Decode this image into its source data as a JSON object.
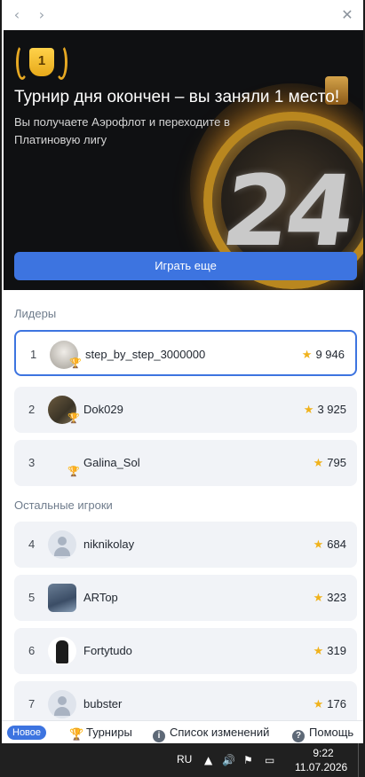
{
  "nav": {
    "back": "‹",
    "forward": "›",
    "close": "✕"
  },
  "hero": {
    "badge_number": "1",
    "title": "Турнир дня окончен – вы заняли 1 место!",
    "subtitle": "Вы получаете Аэрофлот и переходите в Платиновую лигу",
    "art_number": "24",
    "play_button": "Играть еще"
  },
  "leaders": {
    "title": "Лидеры",
    "rows": [
      {
        "rank": "1",
        "name": "step_by_step_3000000",
        "score": "9 946",
        "cup": "🏆"
      },
      {
        "rank": "2",
        "name": "Dok029",
        "score": "3 925",
        "cup": "🏆"
      },
      {
        "rank": "3",
        "name": "Galina_Sol",
        "score": "795",
        "cup": "🏆"
      }
    ]
  },
  "others": {
    "title": "Остальные игроки",
    "rows": [
      {
        "rank": "4",
        "name": "niknikolay",
        "score": "684"
      },
      {
        "rank": "5",
        "name": "ARTop",
        "score": "323"
      },
      {
        "rank": "6",
        "name": "Fortytudo",
        "score": "319"
      },
      {
        "rank": "7",
        "name": "bubster",
        "score": "176"
      }
    ]
  },
  "star": "★",
  "bottom_nav": {
    "new_tag": "Новое",
    "tournaments": "Турниры",
    "changelog": "Список изменений",
    "help": "Помощь"
  },
  "taskbar": {
    "lang": "RU",
    "time": "9:22",
    "date": "11.07.2026"
  },
  "colors": {
    "accent": "#3d74e0",
    "star": "#f0b21c",
    "gold": "#e3a514"
  }
}
